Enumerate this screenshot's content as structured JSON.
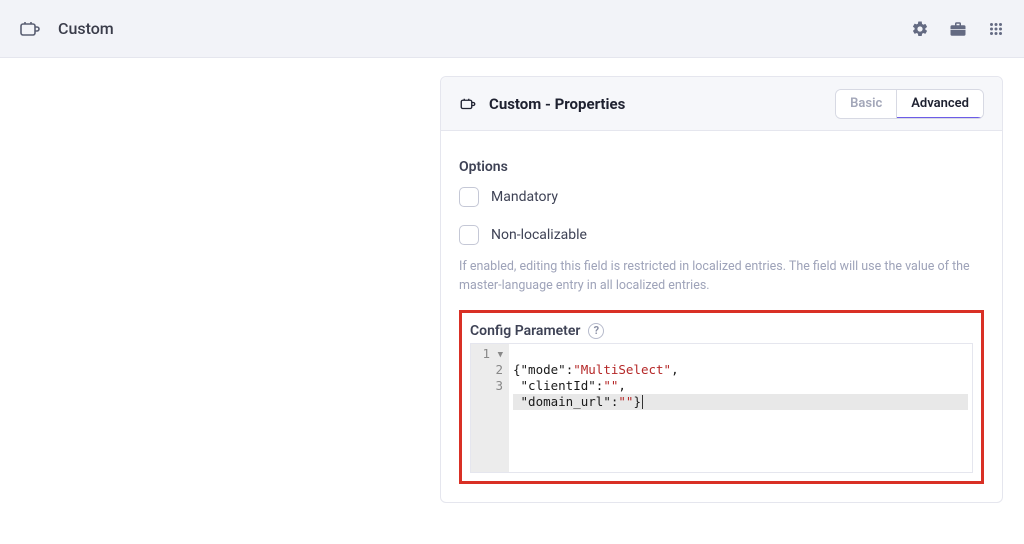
{
  "topbar": {
    "title": "Custom"
  },
  "panel": {
    "title": "Custom - Properties",
    "tabs": {
      "basic": "Basic",
      "advanced": "Advanced"
    }
  },
  "options": {
    "section_label": "Options",
    "mandatory_label": "Mandatory",
    "nonlocalizable_label": "Non-localizable",
    "helper": "If enabled, editing this field is restricted in localized entries. The field will use the value of the master-language entry in all localized entries."
  },
  "config": {
    "label": "Config Parameter",
    "line_numbers": [
      "1",
      "2",
      "3"
    ],
    "lines": {
      "l1": {
        "k_mode": "\"mode\"",
        "v_mode": "\"MultiSelect\""
      },
      "l2": {
        "k_client": "\"clientId\"",
        "v_client": "\"\""
      },
      "l3": {
        "k_domain": "\"domain_url\"",
        "v_domain": "\"\""
      }
    }
  }
}
